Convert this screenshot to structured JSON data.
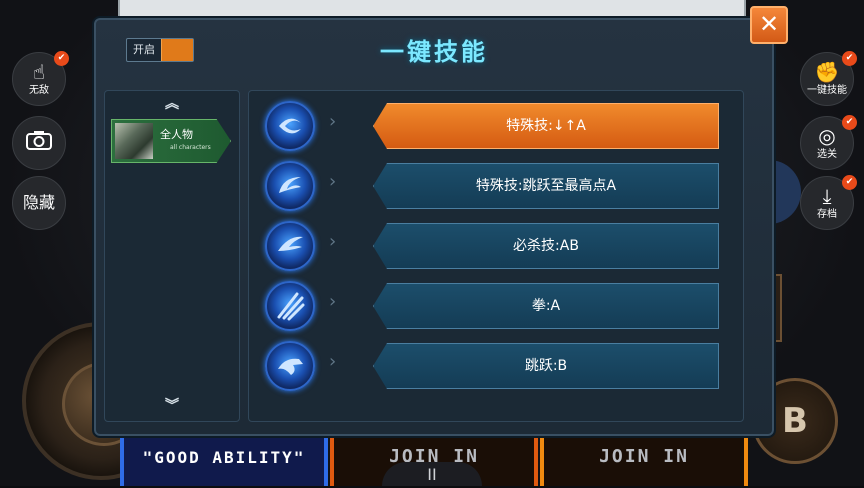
{
  "background": {
    "slots": [
      "\"GOOD ABILITY\"",
      "JOIN IN",
      "JOIN IN"
    ],
    "pause_glyph": "II",
    "b_button": "B"
  },
  "left_controls": {
    "invincible": {
      "label": "无敌",
      "icon": "hand-icon"
    },
    "camera": {
      "icon": "camera-icon"
    },
    "hide": {
      "label": "隐藏"
    }
  },
  "right_controls": {
    "one_key": {
      "label": "一键技能",
      "icon": "fist-icon"
    },
    "stage": {
      "label": "选关",
      "icon": "target-icon"
    },
    "save": {
      "label": "存档",
      "icon": "download-icon"
    }
  },
  "badge_glyph": "✔",
  "modal": {
    "toggle_label": "开启",
    "title": "一键技能",
    "close_glyph": "✕",
    "nav_up": "︽",
    "nav_down": "︾",
    "character": {
      "name": "全人物",
      "subtitle": "all characters"
    },
    "skills": [
      {
        "label": "特殊技:↓↑A",
        "active": true
      },
      {
        "label": "特殊技:跳跃至最高点A",
        "active": false
      },
      {
        "label": "必杀技:AB",
        "active": false
      },
      {
        "label": "拳:A",
        "active": false
      },
      {
        "label": "跳跃:B",
        "active": false
      }
    ],
    "row_arrow": "›"
  },
  "colors": {
    "accent": "#e07a1a",
    "title": "#7ce8ff",
    "panel": "#1b2935"
  }
}
